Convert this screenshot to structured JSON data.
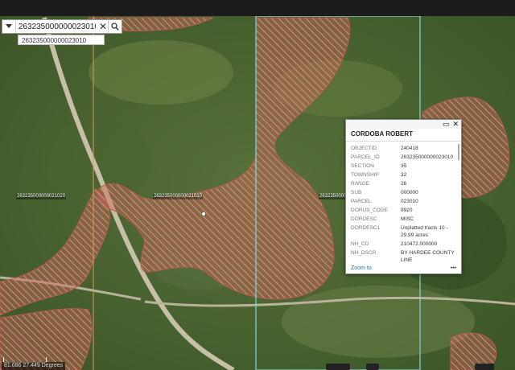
{
  "search": {
    "value": "263235000000023010"
  },
  "suggestion": "263235000000023010",
  "parcel_labels": [
    "263235000000021020",
    "263235000000021010",
    "2632350000"
  ],
  "popup": {
    "title": "CORDOBA ROBERT",
    "fields": [
      {
        "key": "OBJECTID",
        "value": "240418"
      },
      {
        "key": "PARCEL_ID",
        "value": "263235000000023010"
      },
      {
        "key": "SECTION",
        "value": "35"
      },
      {
        "key": "TOWNSHIP",
        "value": "32"
      },
      {
        "key": "RANGE",
        "value": "26"
      },
      {
        "key": "SUB",
        "value": "000000"
      },
      {
        "key": "PARCEL",
        "value": "023010"
      },
      {
        "key": "DORUS_CODE",
        "value": "9920"
      },
      {
        "key": "DORDESC",
        "value": "MISC"
      },
      {
        "key": "DORDESC1",
        "value": "Unplatted tracts 10 - 29.99 acres"
      },
      {
        "key": "NH_CD",
        "value": "210472.000000"
      },
      {
        "key": "NH_DSCR",
        "value": "BY HARDEE COUNTY LINE"
      }
    ],
    "zoom_label": "Zoom to",
    "more_label": "•••"
  },
  "coordinates": "81.686 27.449 Degrees",
  "colors": {
    "parcel_fill": "#c96a5e",
    "selection_outline": "#7fd6e0",
    "section_line": "#d89a5a"
  }
}
